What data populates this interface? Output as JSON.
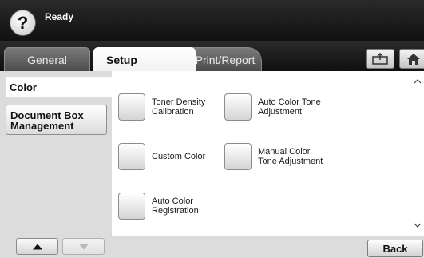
{
  "status": {
    "help_symbol": "?",
    "text": "Ready"
  },
  "tabs": [
    {
      "label": "General"
    },
    {
      "label": "Setup"
    },
    {
      "label": "Print/Report"
    }
  ],
  "header_icons": [
    "tray-icon",
    "home-icon"
  ],
  "categories": [
    {
      "label": "Color",
      "selected": true
    },
    {
      "label": "Document Box\nManagement",
      "selected": false
    }
  ],
  "options": [
    {
      "label": "Toner Density\nCalibration"
    },
    {
      "label": "Auto Color Tone\nAdjustment"
    },
    {
      "label": "Custom Color"
    },
    {
      "label": "Manual Color\nTone Adjustment"
    },
    {
      "label": "Auto Color\nRegistration"
    }
  ],
  "buttons": {
    "back": "Back"
  },
  "colors": {
    "status_bg": "#1a1a1a",
    "panel_bg": "#dcdcdc",
    "content_bg": "#ffffff"
  }
}
